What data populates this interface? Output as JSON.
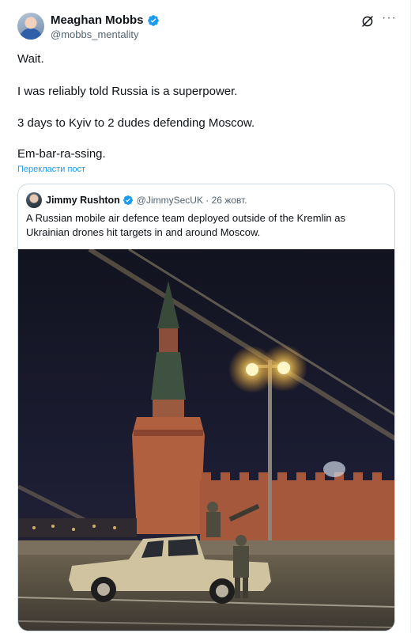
{
  "author": {
    "name": "Meaghan Mobbs",
    "handle": "@mobbs_mentality",
    "verified": true
  },
  "tweet": {
    "lines": [
      "Wait.",
      "I was reliably told Russia is a superpower.",
      "3 days to Kyiv to 2 dudes defending Moscow.",
      "Em-bar-ra-ssing."
    ],
    "translate_label": "Перекласти пост"
  },
  "quoted": {
    "name": "Jimmy Rushton",
    "handle_date": "@JimmySecUK · 26 жовт.",
    "verified": true,
    "text": "A Russian mobile air defence team deployed outside of the Kremlin as Ukrainian drones hit targets in and around Moscow."
  },
  "icons": {
    "verified": "verified-badge-icon",
    "grok": "grok-icon",
    "more": "more-icon"
  },
  "colors": {
    "accent": "#1d9bf0",
    "text": "#0f1419",
    "muted": "#536471",
    "border": "#cfd9de"
  }
}
